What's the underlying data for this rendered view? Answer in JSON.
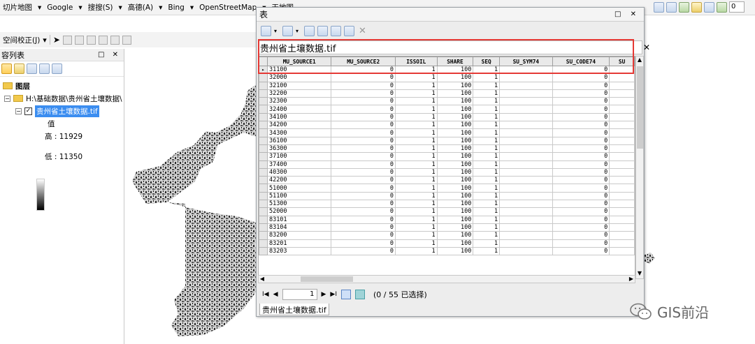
{
  "toolbar_top": {
    "menus": [
      "切片地图",
      "Google",
      "搜搜(S)",
      "高德(A)",
      "Bing",
      "OpenStreetMap",
      "天地图"
    ],
    "zoom_value": "0"
  },
  "toolbar_second": {
    "label": "空间校正(J)"
  },
  "toc": {
    "title": "容列表",
    "layers_label": "图层",
    "path_label": "H:\\基础数据\\贵州省土壤数据\\",
    "layer_name": "贵州省土壤数据.tif",
    "value_label": "值",
    "high_label": "高 : 11929",
    "low_label": "低 : 11350"
  },
  "table_window": {
    "title": "表",
    "tab_caption": "贵州省土壤数据.tif",
    "bottom_tab": "贵州省土壤数据.tif",
    "columns": [
      "MU_SOURCE1",
      "MU_SOURCE2",
      "ISSOIL",
      "SHARE",
      "SEQ",
      "SU_SYM74",
      "SU_CODE74",
      "SU"
    ],
    "rows": [
      [
        "31100",
        "0",
        "1",
        "100",
        "1",
        "",
        "0"
      ],
      [
        "32000",
        "0",
        "1",
        "100",
        "1",
        "",
        "0"
      ],
      [
        "32100",
        "0",
        "1",
        "100",
        "1",
        "",
        "0"
      ],
      [
        "32200",
        "0",
        "1",
        "100",
        "1",
        "",
        "0"
      ],
      [
        "32300",
        "0",
        "1",
        "100",
        "1",
        "",
        "0"
      ],
      [
        "32400",
        "0",
        "1",
        "100",
        "1",
        "",
        "0"
      ],
      [
        "34100",
        "0",
        "1",
        "100",
        "1",
        "",
        "0"
      ],
      [
        "34200",
        "0",
        "1",
        "100",
        "1",
        "",
        "0"
      ],
      [
        "34300",
        "0",
        "1",
        "100",
        "1",
        "",
        "0"
      ],
      [
        "36100",
        "0",
        "1",
        "100",
        "1",
        "",
        "0"
      ],
      [
        "36300",
        "0",
        "1",
        "100",
        "1",
        "",
        "0"
      ],
      [
        "37100",
        "0",
        "1",
        "100",
        "1",
        "",
        "0"
      ],
      [
        "37400",
        "0",
        "1",
        "100",
        "1",
        "",
        "0"
      ],
      [
        "40300",
        "0",
        "1",
        "100",
        "1",
        "",
        "0"
      ],
      [
        "42200",
        "0",
        "1",
        "100",
        "1",
        "",
        "0"
      ],
      [
        "51000",
        "0",
        "1",
        "100",
        "1",
        "",
        "0"
      ],
      [
        "51100",
        "0",
        "1",
        "100",
        "1",
        "",
        "0"
      ],
      [
        "51300",
        "0",
        "1",
        "100",
        "1",
        "",
        "0"
      ],
      [
        "52000",
        "0",
        "1",
        "100",
        "1",
        "",
        "0"
      ],
      [
        "83101",
        "0",
        "1",
        "100",
        "1",
        "",
        "0"
      ],
      [
        "83104",
        "0",
        "1",
        "100",
        "1",
        "",
        "0"
      ],
      [
        "83200",
        "0",
        "1",
        "100",
        "1",
        "",
        "0"
      ],
      [
        "83201",
        "0",
        "1",
        "100",
        "1",
        "",
        "0"
      ],
      [
        "83203",
        "0",
        "1",
        "100",
        "1",
        "",
        "0"
      ]
    ],
    "page_value": "1",
    "status": "(0 / 55 已选择)"
  },
  "watermark": "GIS前沿",
  "colors": {
    "highlight_box": "#e53935",
    "selected_layer": "#3b8df0"
  }
}
